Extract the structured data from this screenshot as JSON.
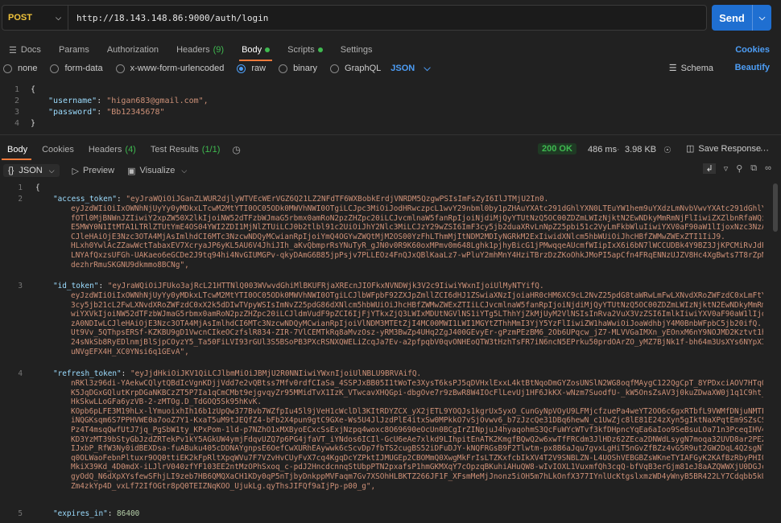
{
  "request": {
    "method": "POST",
    "url": "http://18.143.148.86:9000/auth/login",
    "send_label": "Send"
  },
  "request_tabs": {
    "docs": "Docs",
    "params": "Params",
    "authorization": "Authorization",
    "headers": "Headers",
    "headers_count": "(9)",
    "body": "Body",
    "scripts": "Scripts",
    "settings": "Settings",
    "cookies": "Cookies"
  },
  "body_options": {
    "none": "none",
    "form_data": "form-data",
    "urlencoded": "x-www-form-urlencoded",
    "raw": "raw",
    "binary": "binary",
    "graphql": "GraphQL",
    "format": "JSON",
    "schema": "Schema",
    "beautify": "Beautify"
  },
  "request_body": {
    "lines": [
      "1",
      "2",
      "3",
      "4"
    ],
    "open": "{",
    "username_key": "\"username\"",
    "username_val": "\"higan683@gmail.com\",",
    "password_key": "\"password\"",
    "password_val": "\"Bb12345678\"",
    "close": "}"
  },
  "response_tabs": {
    "body": "Body",
    "cookies": "Cookies",
    "headers": "Headers",
    "headers_count": "(4)",
    "tests": "Test Results",
    "tests_count": "(1/1)"
  },
  "response_meta": {
    "status": "200 OK",
    "time": "486 ms",
    "size": "3.98 KB",
    "save": "Save Response"
  },
  "response_toolbar": {
    "format": "JSON",
    "preview": "Preview",
    "visualize": "Visualize"
  },
  "response_body": {
    "ln1": "1",
    "ln2": "2",
    "ln3": "3",
    "ln4": "4",
    "ln5": "5",
    "open": "{",
    "access_key": "\"access_token\"",
    "access_val": "\"eyJraWQiOiJGanZLWUR2djlyWTVEcWErVGZ6Q21LZ2NFdTF6WXBobkErdjVNRDM5QzgwPSIsImFsZyI6IlJTMjU2In0.",
    "access_cont": [
      "eyJzdWIiOiIxOWNhNjUyYy0yMDkxLTcwM2MtYTI0OC05ODk0MWVhNWI0OTgiLCJpc3MiOiJodHRwczpcL1wvY29nbml0by1pZHAuYXAtc291dGhlYXN0LTEuYW1hem9uYXdzLmNvbVwvYXAtc291dGhlYXN0LTF",
      "fOTl0MjBNWnJZIiwiY2xpZW50X2lkIjoiNW52dTFzbWJmaG5rbmx0amRoN2pzZHZpc20iLCJvcmlnaW5fanRpIjoiNjdiMjQyYTUtNzQ5OC00ZDZmLWIzNjktN2EwNDkyMmRmNjFlIiwiZXZlbnRfaWQiOiIxY2",
      "E5MWY0N1ItMTA1LTRlZTUtYmE4OS04YWI2ZDI1MjNlZTUiLCJ0b2tlbl91c2UiOiJhY2Nlc3MiLCJzY29wZSI6ImF3cy5jb2duaXRvLnNpZ25pbi51c2VyLmFkbWluIiwiYXV0aF90aW1lIjoxNzc3NzA0NDIwL",
      "CJleHAiOjE3Nzc3OTA4MjAsImlhdCI6MTc3NzcwNDQyMCwianRpIjoiYmQ4OGYwZWQtMjM2OS00YzFhLThmMjItNDM2MDIyNGRkM2ExIiwidXNlcm5hbWUiOiJhcHBfZWMwZWExZTI1IiJ9.",
      "HLxh0YwlAcZZawWctTabaxEV7XcryaJP6yKL5AU6V4JhiJIh_aKvQbmprRsYNuTyR_gJN0v0R9K60oxMPmv0m648Lghk1pjhyBicG1jPMwqqeAUcmfWIipIxX6i6bN7lWCCUDBk4Y9BZ3JjKPCMiRvJdP7raJqt",
      "LNYAfQxzsUFGh-UAKaeo6eGCDe2J9tq94hi4NvGIUMGPv-qkyDAmG6B85jpPsjv7PLLEOz4FnQJxQBlKaaLz7-wPluY2mhMnY4HziTBrzDzZKoOhkJMoPI5apCfn4FRqENNzUJZV8Hc4XgBwts7T8rZpND2x8KT",
      "dezhrRmuSKGNU9dkmmo8BCNg\","
    ],
    "id_key": "\"id_token\"",
    "id_val": "\"eyJraWQiOiJFUko3ajRcL21HTTNlQ003WVwvdGhiMlBKUFRjaXREcnJIOFkxNVNDWjk3V2c9IiwiYWxnIjoiUlMyNTYifQ.",
    "id_cont": [
      "eyJzdWIiOiIxOWNhNjUyYy0yMDkxLTcwM2MtYTI0OC05ODk0MWVhNWI0OTgiLCJlbWFpbF92ZXJpZmllZCI6dHJ1ZSwiaXNzIjoiaHR0cHM6XC9cL2NvZ25pdG8taWRwLmFwLXNvdXRoZWFzdC0xLmFtYXpvbmF",
      "3cy5jb21cL2FwLXNvdXRoZWFzdC0xX2k5dDIwTVpyWSIsImNvZ25pdG86dXNlcm5hbWUiOiJhcHBfZWMwZWExZTIiLCJvcmlnaW5fanRpIjoiNjdiMjQyYTUtNzQ5OC00ZDZmLWIzNjktN2EwNDkyMmRmNjFlIi",
      "wiYXVkIjoiNW52dTFzbWJmaG5rbmx0amRoN2pzZHZpc20iLCJldmVudF9pZCI6IjFjYTkxZjQ3LWIxMDUtNGVlNS1iYTg5LThhYjZkMjUyM2VlNSIsInRva2VuX3VzZSI6ImlkIiwiYXV0aF90aW1lIjoxNzc3N",
      "zA0NDIwLCJleHAiOjE3Nzc3OTA4MjAsImlhdCI6MTc3NzcwNDQyMCwianRpIjoiVlNDM3MTEtZjI4MC00MWI1LWI1MGYtZThhMmI3YjY5YzFlIiwiZW1haWwiOiJoaWdhbjY4M0BnbWFpbC5jb20ifQ.",
      "Ut9Vv_5QThpsERSf-KZKBU9gD1VwcnCIkeOCzfslR834-ZIR-7VlCEMTkRq8aMvzOsz-yRM3BwZp4UHq2ZgJ400GEvyEr-gPzmPEzBM6_2Ob6UPqcw_jZ7-MLVVGaIMXn_yEOnxM6nY9NOJMD2Kztvt1hYPELLL",
      "24sNkSb8RyEDlnmjBlSjpCOyzY5_Ta50FiLVI93rGUl3S5BSoPB3PXcRSNXQWELiZcqJa7Ev-a2pfpqbV0qvONHEoQTW3tHzhTsFR7iN6ncN5EPrku50prdOArZO_yMZ7BjNk1f-bh64m3UsXYs6NYpXIHFGn7v",
      "uNVgEFX4H_XC0YNsi6q1GEvA\","
    ],
    "refresh_key": "\"refresh_token\"",
    "refresh_val": "\"eyJjdHkiOiJKV1QiLCJlbmMiOiJBMjU2R0NNIiwiYWxnIjoiUlNBLU9BRVAifQ.",
    "refresh_cont": [
      "nRKl3z96di-YAekwCQlytQBdIcVgnKDjjVdd7e2vQBtss7Mfv0rdfCIaSa_4SSPJxBB05I1tWoTe3XysT6ksPJ5qDVHxlExxL4ktBtNqoDmGYZosUNSlN2WG8oqfMAygC122QgCpT_8YPDxciAOV7HTqQIjB3ba",
      "K5JqDGxGQlutKrpDGaNKBCzZT5P7Ia1qCmCMbt9ejgvqyZr95MMidTvX1IzK_VTwcavXHQGpi-dbgOve7r9zBwR8W4IOcFlLevUj1HF6JkKX-wNzm7SuodfU-_kW5OnsZsAV3j0kuZDwaXW0j1q1C9ht_joJ-o9",
      "HkSkwLLoGFa6yzVB-2-zMTOg.D_TdGOQ5Sk95hKvK.",
      "KOpb6pLFE3M19hLx-lYmuoixhIh16b1zUpQw377Bvb7WZfpIu45l9jVeH1cWclDl3KItRDYZCX_yX2jETL9YOQJs1kgrUx5yxO_CunGyNpVOyU9LFMjcfzuePa4weYT2OO6c6gxRTbfL9VWMfDNjuNMTFOs1R",
      "iNQGKsqm6S7PPHVWE0a7ooZ7Y1-KxaT5uM9tJEQfZ4-bFb2X4pun9gtC9GXe-Ws5U4JlJzdPlE4itxSw0MPkkO7vSjOvwv6_b7zJzcQe31DBq6hewN_c1UwZjc8lE81E24zXyn5gIktNaXPqtEm9SZsCSNXzfMW",
      "Pz4T4msqQwfUtJ7jq_PgSbW1ty_KPxPom-1ld-p7NZhO1xMXByoECxcSsExjNzpq4woxc8O69690eOcUn0BCgIrZINpjuJ4hyaqohmS3QcFuWYcWTvf3kfDHpncYqEa6aIoo9SeBsuLOa71n3PceqIHV4L7s5oG",
      "KD3YzMT39bStyGbJzdZRTekPv1kY5AGkUW4ymjFdqvUZQ7p6PG4jfaVT_iYNdos6ICIl-GcU6eAe7xlkd9LIhpitEnATK2KmgfBQwQ2w6xwTfFRCdm3JlHDz62ZEca2DNWdLsygN7moqa32UVD8ar2PEZ0mlC_",
      "IJxbP_RfW3Ny0idBEXDsa-fuABuku405cDDNAYgnpsE6OefCwXURhEAywwk6cScvDp7fbTS2cugBS52iDFuDJY-kNQFRGsB9F2Tlwtm-px8B6aJqu7gvxLgHiT5nGvZfBZz4vG5R9ut2GW2DqL4Q2sgNlc78df",
      "q0OLWaoFebnPltuxr9OQ0ttiEK2kFpRltXpqWVu7F7VZvHvCUyFvX7cq4KgqDcYZPktIJMUGEp2CBOMmQ0XwgMkFrIsLTZKxfcbIkXV4T2V9SNBLZN-L4UOShVEBGBZsWKneTYIAFGyK2KAfBzRbyPHI04AIRw",
      "MkiX39Kd_4D0mdX-iLJlrV040zfYF103EE2ntMzOPhSxoq_c-pdJ2HncdcnnqStUbpPTN2pxafsP1hmGKMXqY7cOpzqBKuhiAHuQW8-wIvIOXL1VuxmfQh3cqQ-bfVqB3erGjm81eJ8aAZQWWXjU0DGJcH8yky",
      "gyOdQ_N6dXpXYsfewSFhjLI9zeb7HB6QMQXaCH1KDy0qP5nTjbyDnkppMVFaqm7Gv7XSOhHLBKTZ266JF1F_XFsmMeMjJnonz5iOH5m7hLkOnfX377IYnlUcKtgslxmzWD4yWnyB5BR422LY7Cdqbb5kUNDge",
      "Zm4zkYp4D_vxLf72IfOGtr8pQ0TEIZNqKOO_UjukLg.qyThsJIFQf9aIjPp-p00_g\","
    ],
    "expires_key": "\"expires_in\"",
    "expires_val": "86400"
  }
}
